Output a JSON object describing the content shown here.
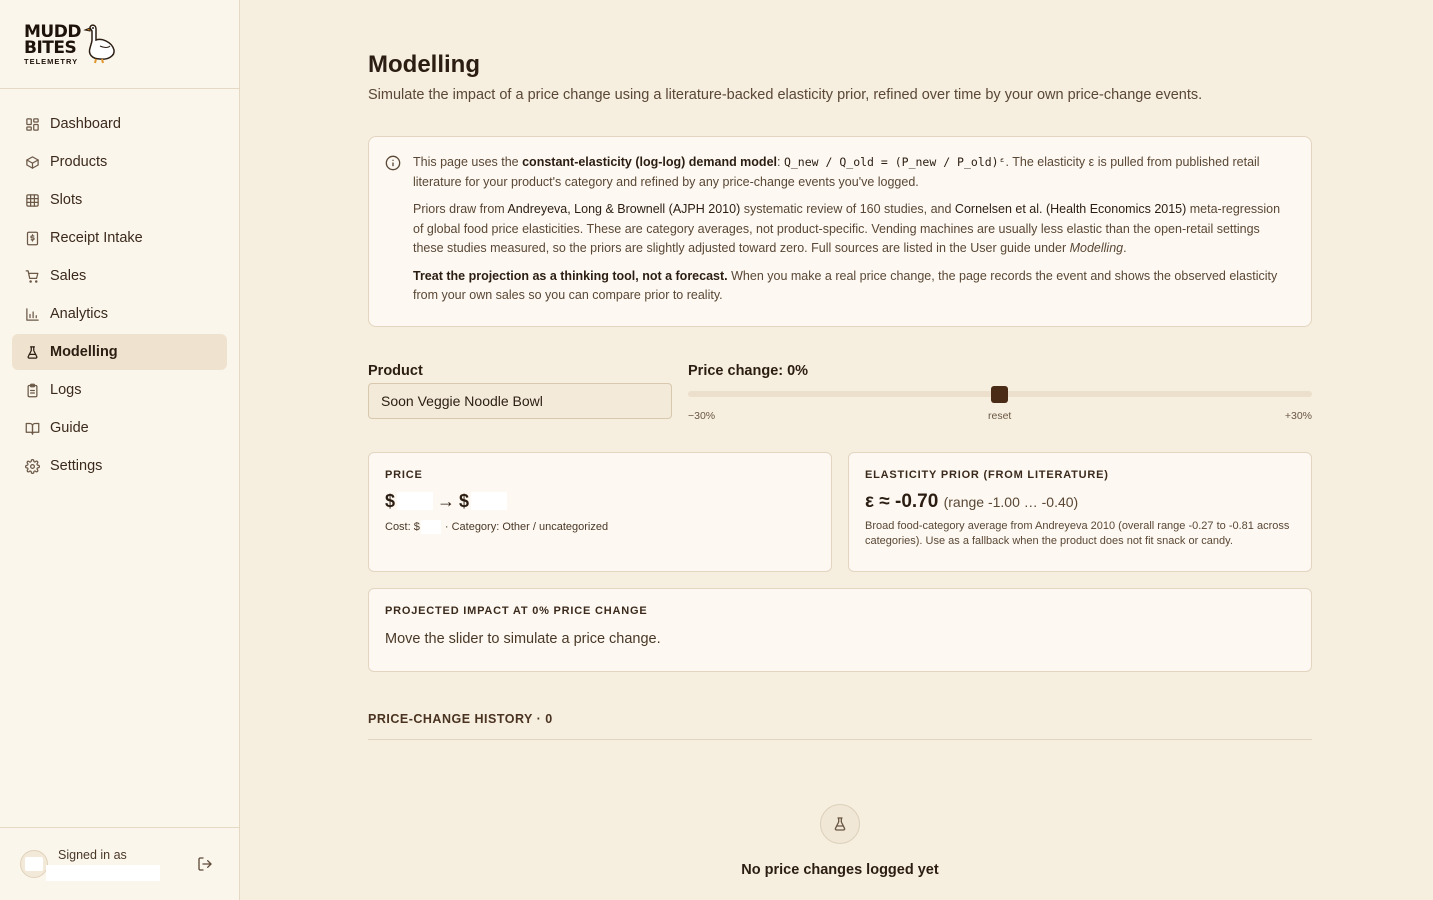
{
  "brand": {
    "line1": "MUDD",
    "line2": "BITES",
    "sub": "TELEMETRY"
  },
  "nav": [
    {
      "label": "Dashboard",
      "icon": "dashboard-icon"
    },
    {
      "label": "Products",
      "icon": "box-icon"
    },
    {
      "label": "Slots",
      "icon": "grid-icon"
    },
    {
      "label": "Receipt Intake",
      "icon": "receipt-icon"
    },
    {
      "label": "Sales",
      "icon": "cart-icon"
    },
    {
      "label": "Analytics",
      "icon": "bar-chart-icon"
    },
    {
      "label": "Modelling",
      "icon": "flask-icon",
      "active": true
    },
    {
      "label": "Logs",
      "icon": "clipboard-icon"
    },
    {
      "label": "Guide",
      "icon": "book-icon"
    },
    {
      "label": "Settings",
      "icon": "gear-icon"
    }
  ],
  "footer": {
    "signed_in_label": "Signed in as"
  },
  "page": {
    "title": "Modelling",
    "subtitle": "Simulate the impact of a price change using a literature-backed elasticity prior, refined over time by your own price-change events."
  },
  "info": {
    "p1_pre": "This page uses the ",
    "p1_bold": "constant-elasticity (log-log) demand model",
    "p1_colon": ": ",
    "p1_formula": "Q_new / Q_old = (P_new / P_old)ᵋ",
    "p1_post": ". The elasticity ε is pulled from published retail literature for your product's category and refined by any price-change events you've logged.",
    "p2_pre": "Priors draw from ",
    "p2_src1": "Andreyeva, Long & Brownell (AJPH 2010)",
    "p2_mid": " systematic review of 160 studies, and ",
    "p2_src2": "Cornelsen et al. (Health Economics 2015)",
    "p2_post": " meta-regression of global food price elasticities. These are category averages, not product-specific. Vending machines are usually less elastic than the open-retail settings these studies measured, so the priors are slightly adjusted toward zero. Full sources are listed in the User guide under ",
    "p2_em": "Modelling",
    "p2_end": ".",
    "p3_bold": "Treat the projection as a thinking tool, not a forecast.",
    "p3_post": " When you make a real price change, the page records the event and shows the observed elasticity from your own sales so you can compare prior to reality."
  },
  "product": {
    "label": "Product",
    "value": "Soon Veggie Noodle Bowl"
  },
  "slider": {
    "label": "Price change: 0%",
    "value_pct": 0,
    "min_label": "−30%",
    "mid_label": "reset",
    "max_label": "+30%"
  },
  "price_card": {
    "title": "PRICE",
    "currency": "$",
    "arrow": "→",
    "cost_label": "Cost: $",
    "category": "· Category: Other / uncategorized"
  },
  "elasticity_card": {
    "title": "ELASTICITY PRIOR (FROM LITERATURE)",
    "value": "ε ≈ -0.70",
    "range": "(range -1.00 … -0.40)",
    "description": "Broad food-category average from Andreyeva 2010 (overall range -0.27 to -0.81 across categories). Use as a fallback when the product does not fit snack or candy."
  },
  "impact_card": {
    "title": "PROJECTED IMPACT AT 0% PRICE CHANGE",
    "message": "Move the slider to simulate a price change."
  },
  "history": {
    "title": "PRICE-CHANGE HISTORY · 0",
    "empty_message": "No price changes logged yet"
  }
}
